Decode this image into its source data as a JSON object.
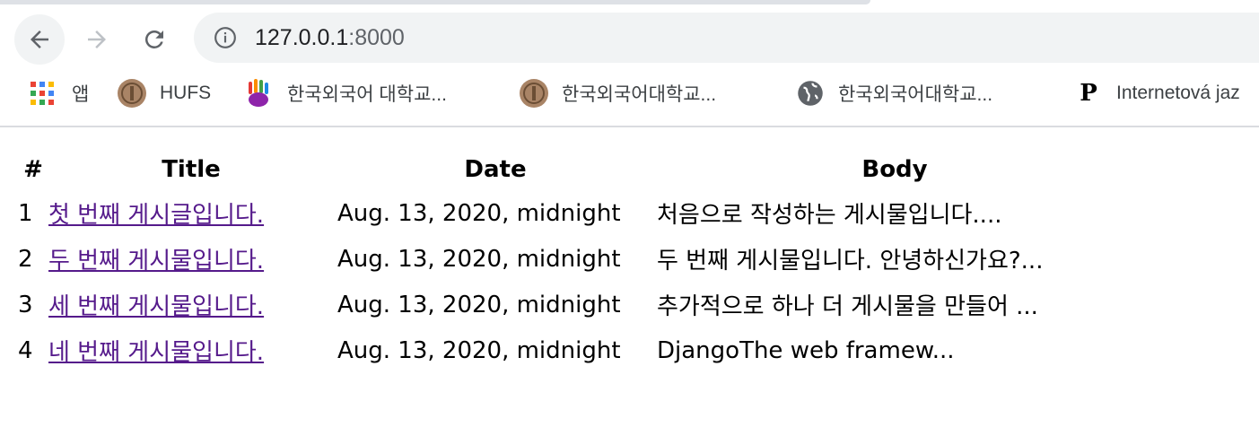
{
  "browser": {
    "url_host": "127.0.0.1",
    "url_port": ":8000",
    "bookmarks": [
      {
        "label": "앱",
        "icon": "apps-grid-icon"
      },
      {
        "label": "HUFS",
        "icon": "hufs-emblem-icon"
      },
      {
        "label": "한국외국어 대학교...",
        "icon": "colorful-hand-icon"
      },
      {
        "label": "한국외국어대학교...",
        "icon": "hufs-emblem-icon"
      },
      {
        "label": "한국외국어대학교...",
        "icon": "globe-icon"
      },
      {
        "label": "Internetová jaz",
        "icon": "p-letter-icon",
        "icon_text": "P"
      }
    ]
  },
  "table": {
    "headers": [
      "#",
      "Title",
      "Date",
      "Body"
    ],
    "rows": [
      {
        "num": "1",
        "title": "첫 번째 게시글입니다.",
        "date": "Aug. 13, 2020, midnight",
        "body": "처음으로 작성하는 게시물입니다...."
      },
      {
        "num": "2",
        "title": "두 번째 게시물입니다.",
        "date": "Aug. 13, 2020, midnight",
        "body": "두 번째 게시물입니다. 안녕하신가요?..."
      },
      {
        "num": "3",
        "title": "세 번째 게시물입니다.",
        "date": "Aug. 13, 2020, midnight",
        "body": "추가적으로 하나 더 게시물을 만들어 ..."
      },
      {
        "num": "4",
        "title": "네 번째 게시물입니다.",
        "date": "Aug. 13, 2020, midnight",
        "body": "DjangoThe web framew..."
      }
    ]
  },
  "colors": {
    "link_visited": "#551a8b",
    "omnibox_bg": "#f1f3f4",
    "icon_gray": "#5f6368"
  }
}
